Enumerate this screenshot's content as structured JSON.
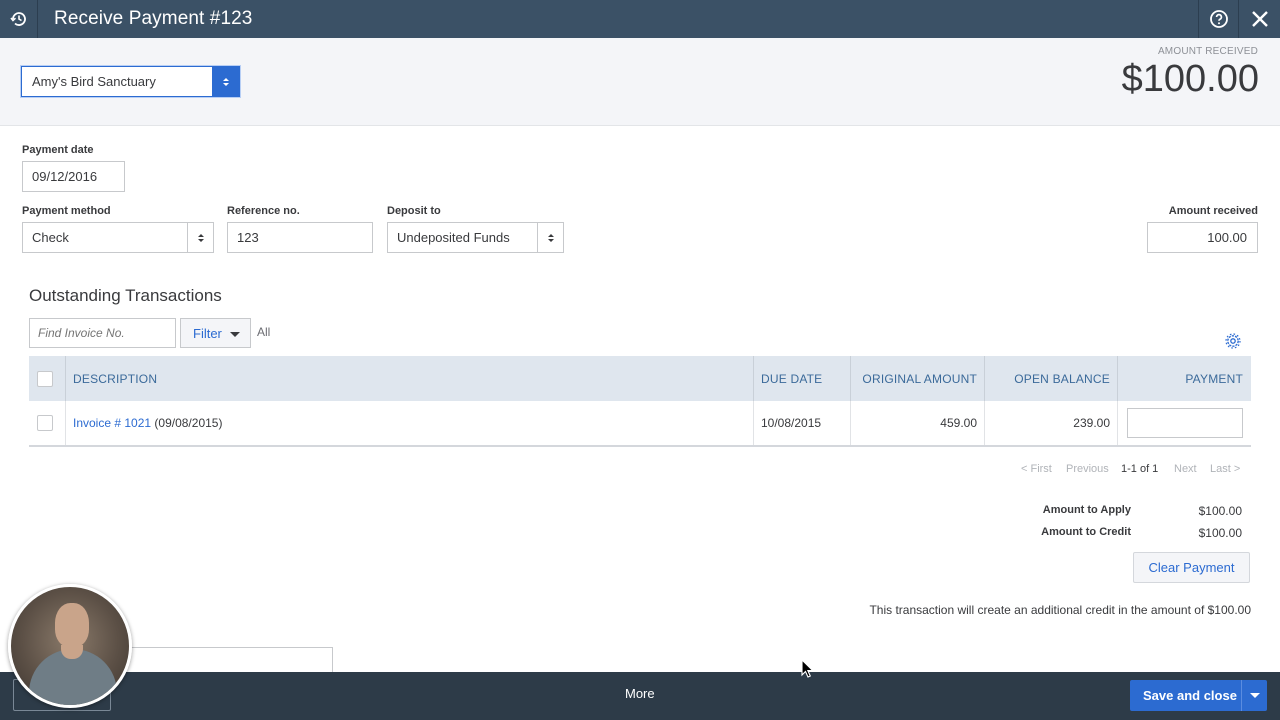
{
  "header": {
    "title": "Receive Payment #123",
    "icons": [
      "history-icon",
      "help-icon",
      "close-icon"
    ]
  },
  "top": {
    "customer": "Amy's Bird Sanctuary",
    "amount_received_label": "AMOUNT RECEIVED",
    "amount_received_value": "$100.00"
  },
  "form": {
    "payment_date_label": "Payment date",
    "payment_date_value": "09/12/2016",
    "payment_method_label": "Payment method",
    "payment_method_value": "Check",
    "reference_label": "Reference no.",
    "reference_value": "123",
    "deposit_label": "Deposit to",
    "deposit_value": "Undeposited Funds",
    "amount_label": "Amount received",
    "amount_value": "100.00"
  },
  "outstanding": {
    "title": "Outstanding Transactions",
    "find_placeholder": "Find Invoice No.",
    "filter_label": "Filter",
    "filter_scope": "All",
    "columns": [
      "DESCRIPTION",
      "DUE DATE",
      "ORIGINAL AMOUNT",
      "OPEN BALANCE",
      "PAYMENT"
    ],
    "rows": [
      {
        "invoice_link": "Invoice # 1021",
        "invoice_date": "(09/08/2015)",
        "due_date": "10/08/2015",
        "original_amount": "459.00",
        "open_balance": "239.00",
        "payment": ""
      }
    ],
    "pager": {
      "first": "< First",
      "previous": "Previous",
      "range": "1-1 of 1",
      "next": "Next",
      "last": "Last >"
    }
  },
  "summary": {
    "apply_label": "Amount to Apply",
    "apply_value": "$100.00",
    "credit_label": "Amount to Credit",
    "credit_value": "$100.00",
    "clear_button": "Clear Payment",
    "note": "This transaction will create an additional credit in the amount of $100.00"
  },
  "footer": {
    "more": "More",
    "save": "Save and close"
  },
  "colors": {
    "header_bg": "#3b5166",
    "accent": "#2c6bd1",
    "footer_bg": "#2d3b48",
    "table_header_bg": "#dfe6ee"
  }
}
